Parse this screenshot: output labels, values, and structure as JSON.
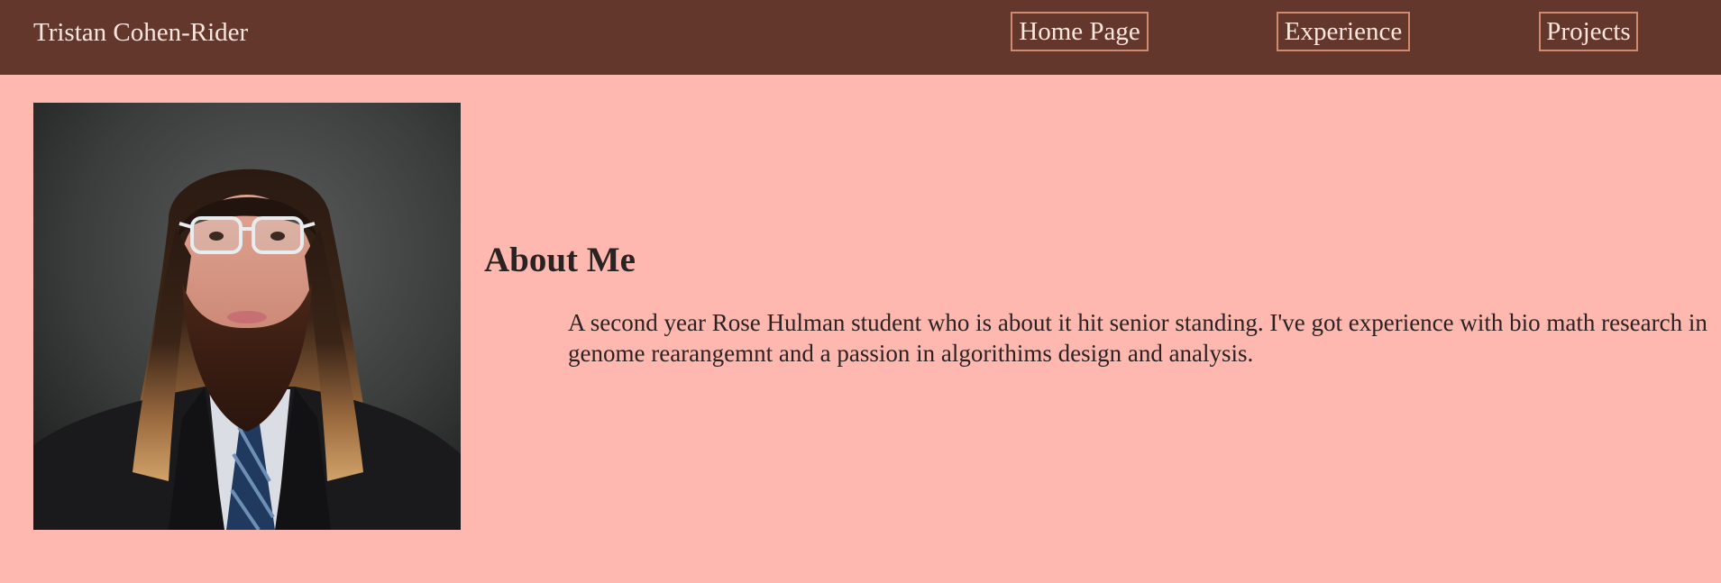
{
  "header": {
    "site_name": "Tristan Cohen-Rider",
    "nav": [
      {
        "label": "Home Page"
      },
      {
        "label": "Experience"
      },
      {
        "label": "Projects"
      }
    ]
  },
  "main": {
    "photo_icon": "profile-photo",
    "about_heading": "About Me",
    "about_text": "A second year Rose Hulman student who is about it hit senior standing. I've got experience with bio math research in genome rearangemnt and a passion in algorithims design and analysis."
  },
  "colors": {
    "header_bg": "#63372c",
    "page_bg": "#ffb8b0",
    "nav_border": "#cf8a70",
    "text_light": "#fde6de",
    "text_dark": "#2b2222"
  }
}
